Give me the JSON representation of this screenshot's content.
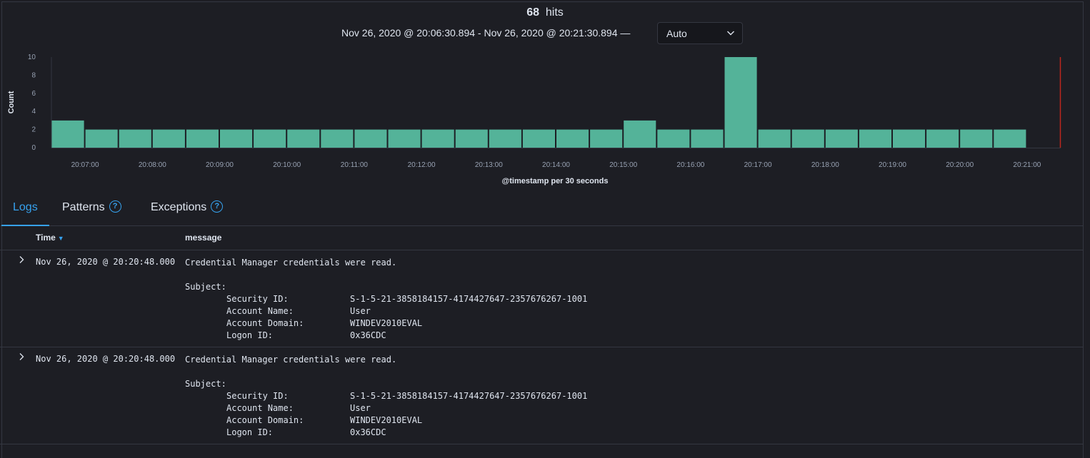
{
  "header": {
    "hits_count": "68",
    "hits_label": "hits",
    "time_range": "Nov 26, 2020 @ 20:06:30.894 - Nov 26, 2020 @ 20:21:30.894 —",
    "interval_value": "Auto"
  },
  "chart_data": {
    "type": "bar",
    "ylabel": "Count",
    "xlabel": "@timestamp per 30 seconds",
    "ylim": [
      0,
      10
    ],
    "yticks": [
      "0",
      "2",
      "4",
      "6",
      "8",
      "10"
    ],
    "xticks": [
      "20:07:00",
      "20:08:00",
      "20:09:00",
      "20:10:00",
      "20:11:00",
      "20:12:00",
      "20:13:00",
      "20:14:00",
      "20:15:00",
      "20:16:00",
      "20:17:00",
      "20:18:00",
      "20:19:00",
      "20:20:00",
      "20:21:00"
    ],
    "categories": [
      "20:06:30",
      "20:07:00",
      "20:07:30",
      "20:08:00",
      "20:08:30",
      "20:09:00",
      "20:09:30",
      "20:10:00",
      "20:10:30",
      "20:11:00",
      "20:11:30",
      "20:12:00",
      "20:12:30",
      "20:13:00",
      "20:13:30",
      "20:14:00",
      "20:14:30",
      "20:15:00",
      "20:15:30",
      "20:16:00",
      "20:16:30",
      "20:17:00",
      "20:17:30",
      "20:18:00",
      "20:18:30",
      "20:19:00",
      "20:19:30",
      "20:20:00",
      "20:20:30",
      "20:21:00"
    ],
    "values": [
      3,
      2,
      2,
      2,
      2,
      2,
      2,
      2,
      2,
      2,
      2,
      2,
      2,
      2,
      2,
      2,
      2,
      3,
      2,
      2,
      10,
      2,
      2,
      2,
      2,
      2,
      2,
      2,
      2,
      0
    ],
    "bar_color": "#54b399",
    "now_marker_color": "#bd271e",
    "grid": false
  },
  "tabs": [
    {
      "label": "Logs",
      "active": true
    },
    {
      "label": "Patterns",
      "help": "?"
    },
    {
      "label": "Exceptions",
      "help": "?"
    }
  ],
  "table": {
    "col_time": "Time",
    "col_message": "message",
    "rows": [
      {
        "time": "Nov 26, 2020 @ 20:20:48.000",
        "message": "Credential Manager credentials were read.",
        "subject_label": "Subject:",
        "fields": [
          {
            "key": "Security ID:",
            "value": "S-1-5-21-3858184157-4174427647-2357676267-1001"
          },
          {
            "key": "Account Name:",
            "value": "User"
          },
          {
            "key": "Account Domain:",
            "value": "WINDEV2010EVAL"
          },
          {
            "key": "Logon ID:",
            "value": "0x36CDC"
          }
        ]
      },
      {
        "time": "Nov 26, 2020 @ 20:20:48.000",
        "message": "Credential Manager credentials were read.",
        "subject_label": "Subject:",
        "fields": [
          {
            "key": "Security ID:",
            "value": "S-1-5-21-3858184157-4174427647-2357676267-1001"
          },
          {
            "key": "Account Name:",
            "value": "User"
          },
          {
            "key": "Account Domain:",
            "value": "WINDEV2010EVAL"
          },
          {
            "key": "Logon ID:",
            "value": "0x36CDC"
          }
        ]
      }
    ]
  },
  "icons": {
    "interval_dropdown": "chevron-down-icon",
    "row_expand": "chevron-right-icon",
    "tab_help": "question-circle-icon",
    "sort": "sort-down-icon"
  },
  "colors": {
    "accent": "#36a2ef",
    "background": "#1d1e24",
    "border": "#343741"
  }
}
